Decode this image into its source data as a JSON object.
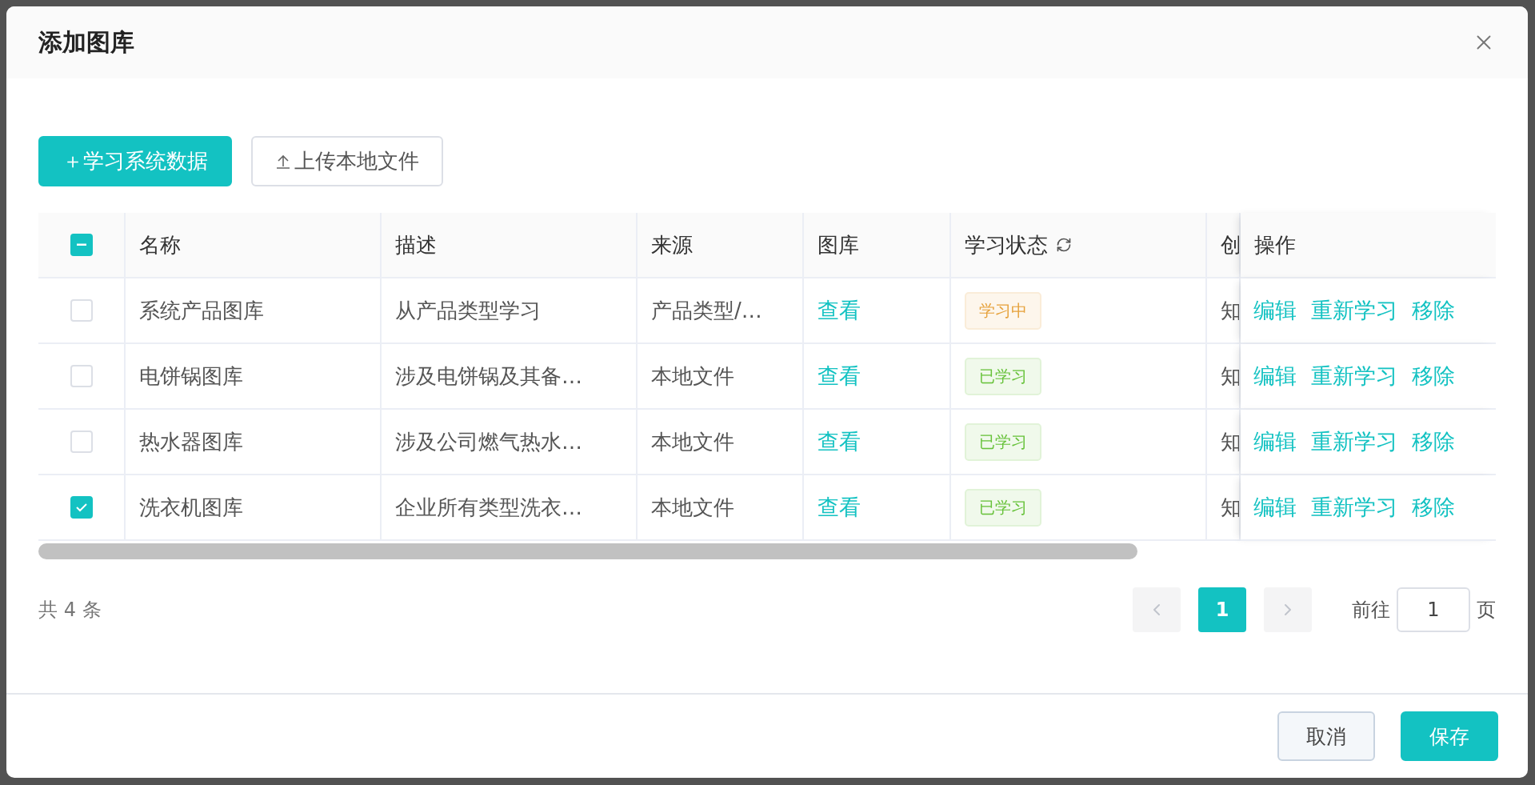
{
  "dialog": {
    "title": "添加图库"
  },
  "toolbar": {
    "buttons": [
      {
        "label": "＋学习系统数据",
        "kind": "primary"
      },
      {
        "label": "上传本地文件",
        "kind": "upload"
      }
    ]
  },
  "table": {
    "select_all": {
      "indeterminate": true
    },
    "columns": [
      "名称",
      "描述",
      "来源",
      "图库",
      "学习状态",
      "创",
      "操作"
    ],
    "rows": [
      {
        "checked": false,
        "name": "系统产品图库",
        "description": "从产品类型学习",
        "source": "产品类型/…",
        "gallery": "查看",
        "status": {
          "label": "学习中",
          "kind": "learning"
        },
        "column_7": "知",
        "actions": [
          "编辑",
          "重新学习",
          "移除"
        ]
      },
      {
        "checked": false,
        "name": "电饼锅图库",
        "description": "涉及电饼锅及其备…",
        "source": "本地文件",
        "gallery": "查看",
        "status": {
          "label": "已学习",
          "kind": "learned"
        },
        "column_7": "知",
        "actions": [
          "编辑",
          "重新学习",
          "移除"
        ]
      },
      {
        "checked": false,
        "name": "热水器图库",
        "description": "涉及公司燃气热水…",
        "source": "本地文件",
        "gallery": "查看",
        "status": {
          "label": "已学习",
          "kind": "learned"
        },
        "column_7": "知",
        "actions": [
          "编辑",
          "重新学习",
          "移除"
        ]
      },
      {
        "checked": true,
        "name": "洗衣机图库",
        "description": "企业所有类型洗衣…",
        "source": "本地文件",
        "gallery": "查看",
        "status": {
          "label": "已学习",
          "kind": "learned"
        },
        "column_7": "知",
        "actions": [
          "编辑",
          "重新学习",
          "移除"
        ]
      }
    ]
  },
  "pagination": {
    "total": "共 4 条",
    "pages": [
      {
        "label": "1",
        "selected": true
      }
    ],
    "goto_label": "前往",
    "goto_value": "1",
    "page_suffix": "页"
  },
  "footer": {
    "buttons": [
      {
        "label": "取消",
        "kind": "default"
      },
      {
        "label": "保存",
        "kind": "primary"
      }
    ]
  }
}
